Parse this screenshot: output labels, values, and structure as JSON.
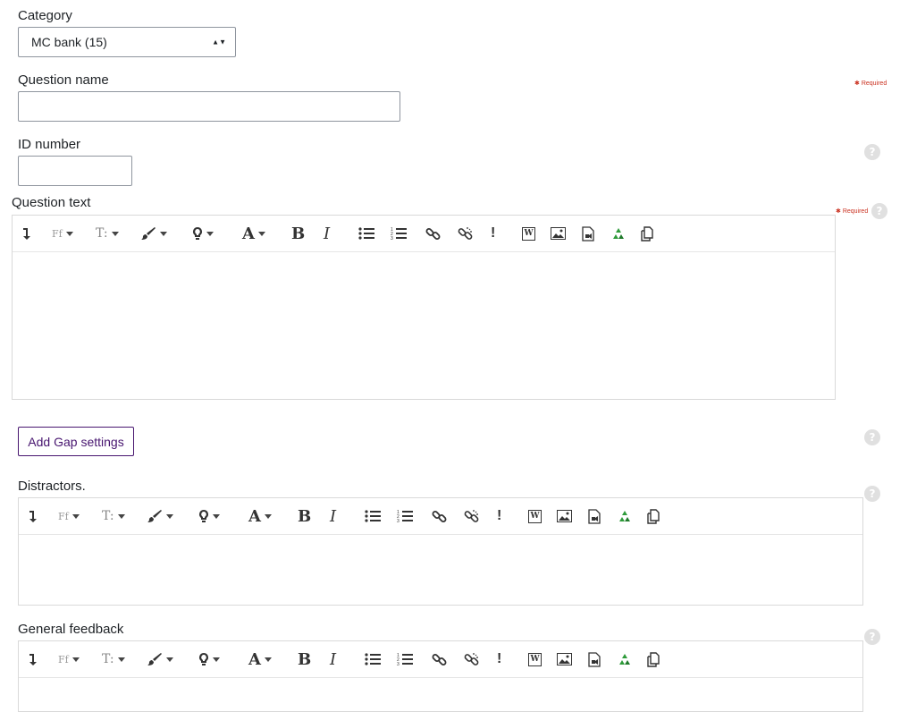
{
  "category": {
    "label": "Category",
    "selected": "MC bank (15)"
  },
  "question_name": {
    "label": "Question name",
    "value": "",
    "required": "Required"
  },
  "id_number": {
    "label": "ID number",
    "value": ""
  },
  "question_text": {
    "label": "Question text",
    "required": "Required"
  },
  "add_gap_button": "Add Gap settings",
  "distractors": {
    "label": "Distractors."
  },
  "general_feedback": {
    "label": "General feedback"
  },
  "toolbar": {
    "font_family_glyph": "Ff",
    "font_size_glyph": "T:",
    "font_color_glyph": "A",
    "bold_glyph": "B",
    "italic_glyph": "I",
    "special_glyph": "!",
    "word_glyph": "W"
  },
  "help_glyph": "?",
  "colors": {
    "accent": "#47156f",
    "required": "#ca3120",
    "recycle": "#2e9b3a"
  }
}
